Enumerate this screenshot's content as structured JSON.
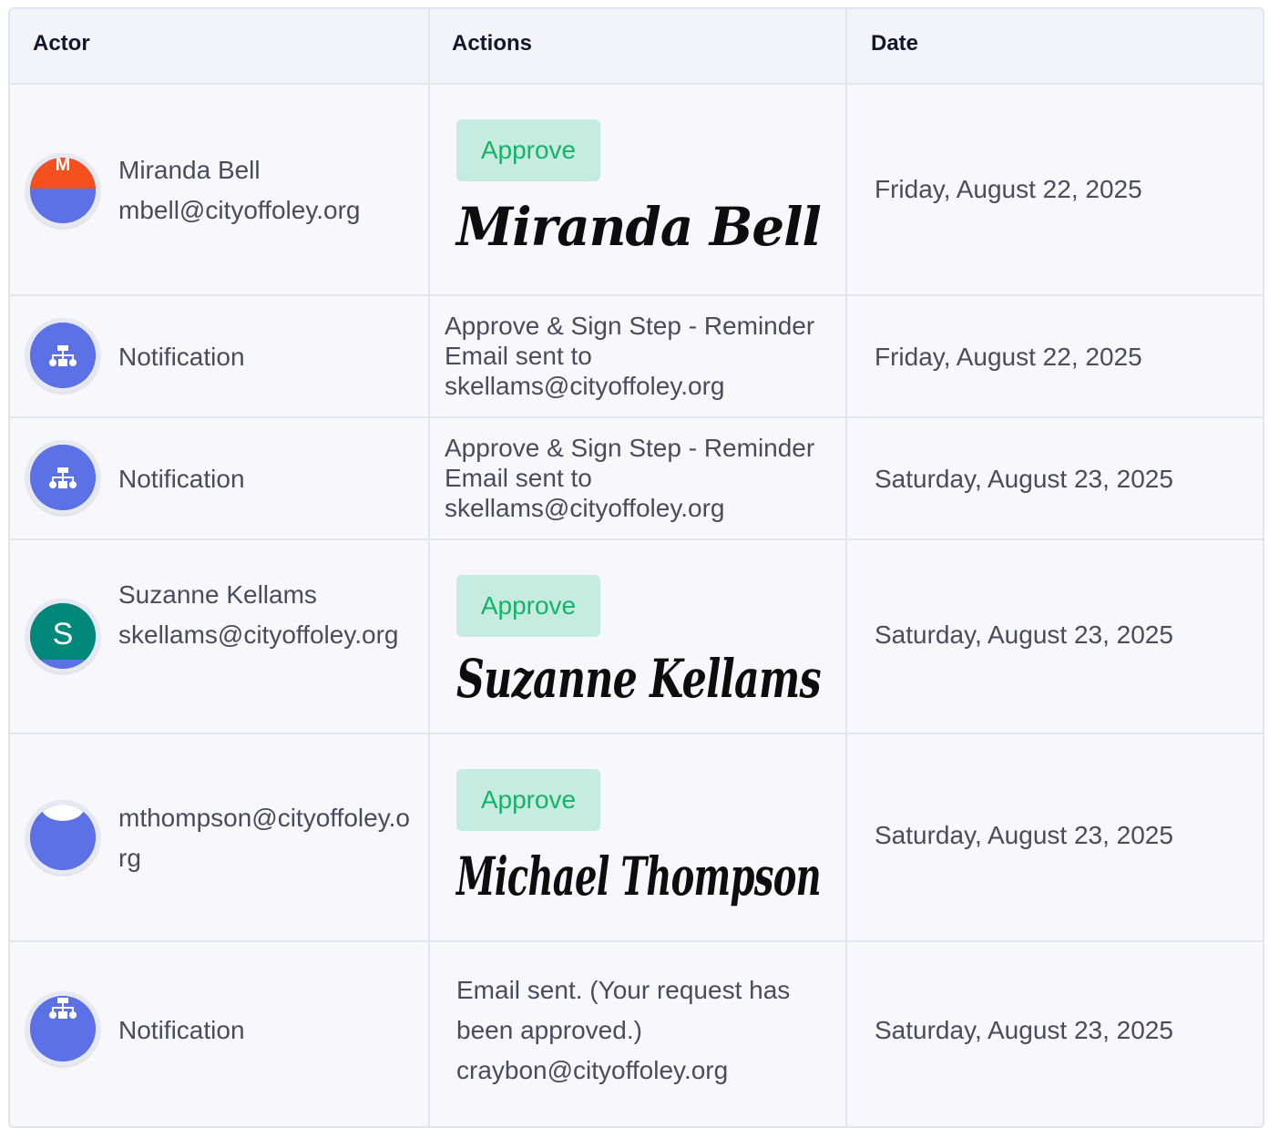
{
  "headers": {
    "actor": "Actor",
    "actions": "Actions",
    "date": "Date"
  },
  "rows": [
    {
      "actor_name": "Miranda Bell",
      "actor_email": "mbell@cityoffoley.org",
      "action_badge": "Approve",
      "signature": "Miranda Bell",
      "date": "Friday, August 22, 2025"
    },
    {
      "actor_name": "Notification",
      "action_text": "Approve & Sign Step - Reminder Email sent to skellams@cityoffoley.org",
      "date": "Friday, August 22, 2025"
    },
    {
      "actor_name": "Notification",
      "action_text": "Approve & Sign Step - Reminder Email sent to skellams@cityoffoley.org",
      "date": "Saturday, August 23, 2025"
    },
    {
      "avatar_letter": "S",
      "actor_name": "Suzanne Kellams",
      "actor_email": "skellams@cityoffoley.org",
      "action_badge": "Approve",
      "signature": "Suzanne Kellams",
      "date": "Saturday, August 23, 2025"
    },
    {
      "actor_email": "mthompson@cityoffoley.org",
      "action_badge": "Approve",
      "signature": "Michael Thompson",
      "date": "Saturday, August 23, 2025"
    },
    {
      "actor_name": "Notification",
      "action_text": "Email sent. (Your request has been approved.) craybon@cityoffoley.org",
      "date": "Saturday, August 23, 2025"
    }
  ],
  "colors": {
    "avatar_blue": "#5b71e5",
    "avatar_teal": "#00897b",
    "avatar_orange": "#f4511e",
    "approve_bg": "#c6ecdf",
    "approve_text": "#17b26a"
  },
  "icons": {
    "notification": "sitemap-icon"
  }
}
